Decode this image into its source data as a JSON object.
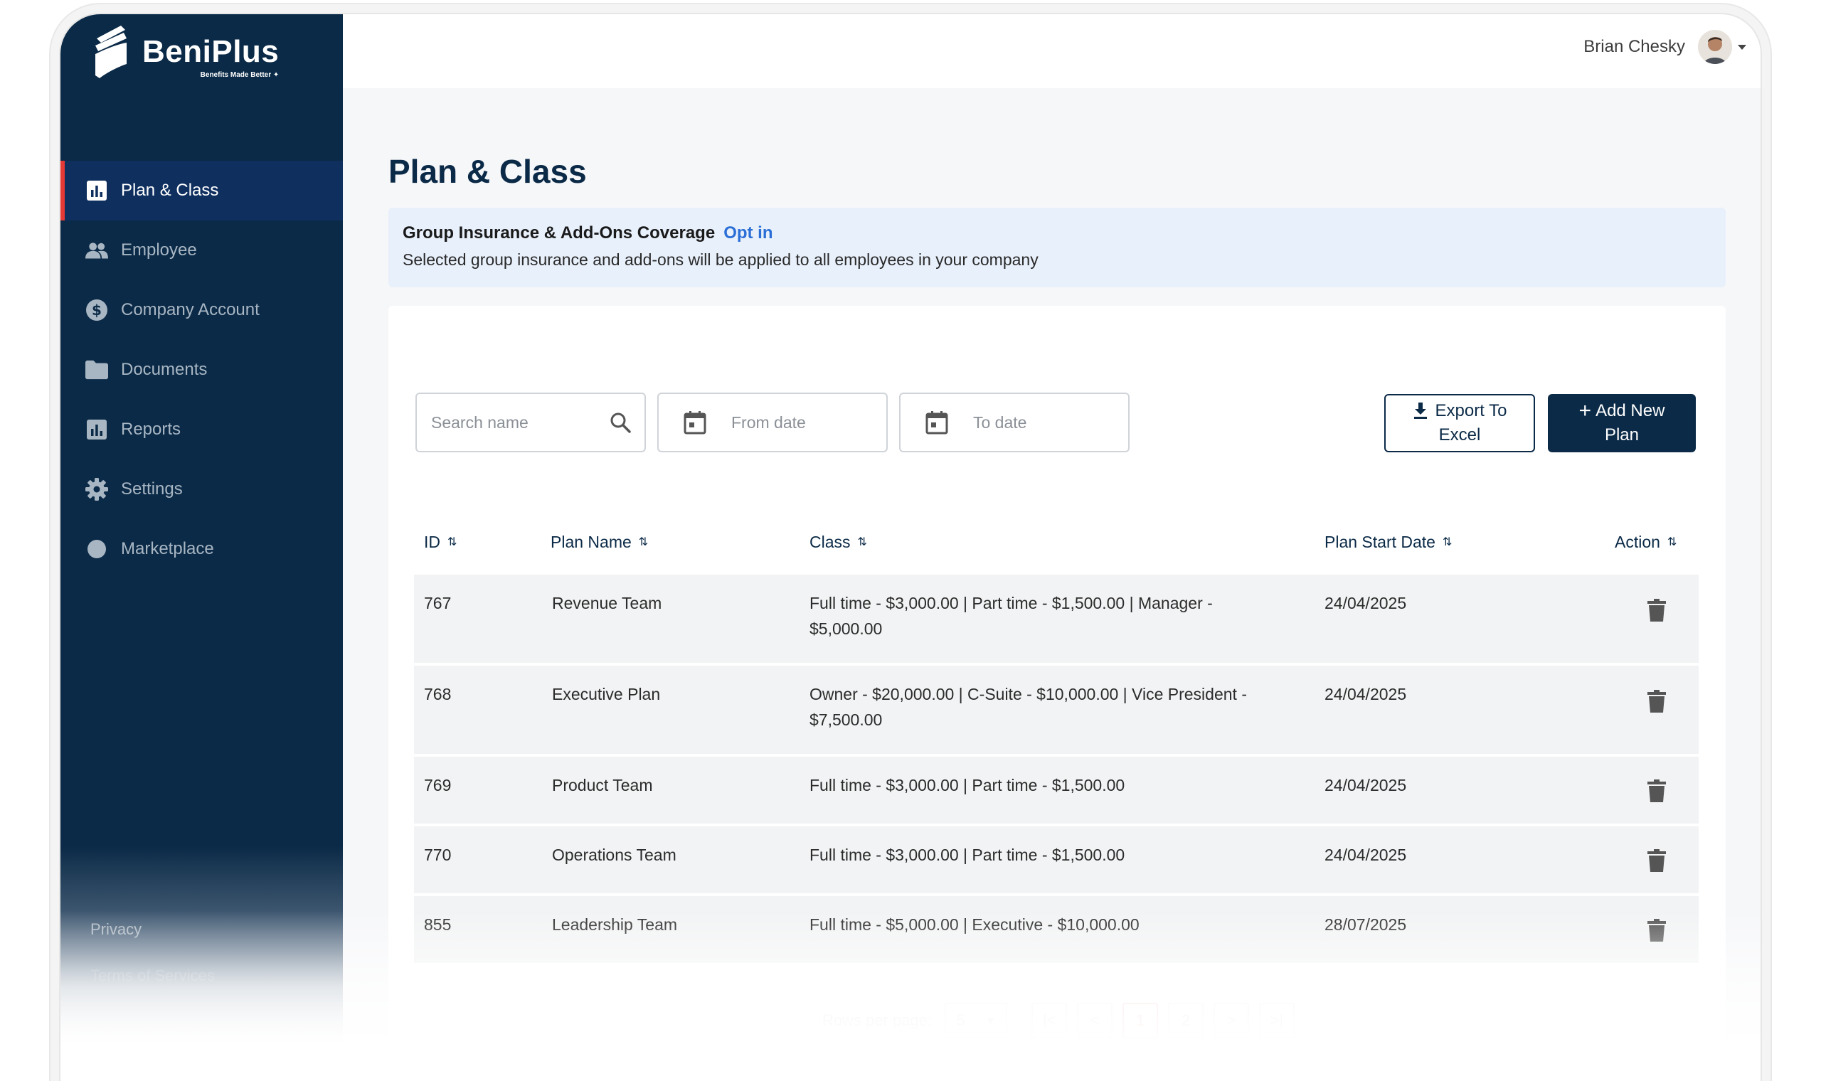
{
  "brand": {
    "name": "BeniPlus",
    "tagline": "Benefits Made Better ✦"
  },
  "header": {
    "user_name": "Brian Chesky"
  },
  "sidebar": {
    "items": [
      {
        "label": "Plan & Class",
        "icon": "bar-chart-icon",
        "active": true
      },
      {
        "label": "Employee",
        "icon": "people-icon",
        "active": false
      },
      {
        "label": "Company Account",
        "icon": "dollar-icon",
        "active": false
      },
      {
        "label": "Documents",
        "icon": "folder-icon",
        "active": false
      },
      {
        "label": "Reports",
        "icon": "report-icon",
        "active": false
      },
      {
        "label": "Settings",
        "icon": "gear-icon",
        "active": false
      },
      {
        "label": "Marketplace",
        "icon": "circle-icon",
        "active": false
      }
    ],
    "footer": {
      "privacy": "Privacy",
      "terms": "Terms of Services"
    }
  },
  "page": {
    "title": "Plan & Class"
  },
  "banner": {
    "title": "Group Insurance & Add-Ons Coverage",
    "link": "Opt in",
    "text": "Selected group insurance and add-ons will be applied to all employees in your company"
  },
  "filters": {
    "search_placeholder": "Search name",
    "from_placeholder": "From date",
    "to_placeholder": "To date"
  },
  "actions": {
    "export_line1": "Export To",
    "export_line2": "Excel",
    "add_line1": "Add New",
    "add_line2": "Plan"
  },
  "table": {
    "columns": [
      "ID",
      "Plan Name",
      "Class",
      "Plan Start Date",
      "Action"
    ],
    "rows": [
      {
        "id": "767",
        "name": "Revenue Team",
        "class_line1": "Full time - $3,000.00 | Part time - $1,500.00 | Manager -",
        "class_line2": "$5,000.00",
        "date": "24/04/2025"
      },
      {
        "id": "768",
        "name": "Executive Plan",
        "class_line1": "Owner - $20,000.00 | C-Suite - $10,000.00 | Vice President -",
        "class_line2": "$7,500.00",
        "date": "24/04/2025"
      },
      {
        "id": "769",
        "name": "Product Team",
        "class_line1": "Full time - $3,000.00 | Part time - $1,500.00",
        "class_line2": "",
        "date": "24/04/2025"
      },
      {
        "id": "770",
        "name": "Operations Team",
        "class_line1": "Full time - $3,000.00 | Part time - $1,500.00",
        "class_line2": "",
        "date": "24/04/2025"
      },
      {
        "id": "855",
        "name": "Leadership Team",
        "class_line1": "Full time - $5,000.00 | Executive - $10,000.00",
        "class_line2": "",
        "date": "28/07/2025"
      }
    ]
  },
  "pagination": {
    "rows_label": "Rows per page:",
    "rows_value": "5",
    "pages": [
      "1",
      "2"
    ],
    "current": "1",
    "first": "|<",
    "prev": "<",
    "next": ">",
    "last": ">|"
  },
  "colors": {
    "navy": "#0b2a47",
    "active_nav": "#0f2f5f",
    "accent_red": "#e53935",
    "link_blue": "#2b6fd6",
    "banner_bg": "#e8f0fb"
  }
}
